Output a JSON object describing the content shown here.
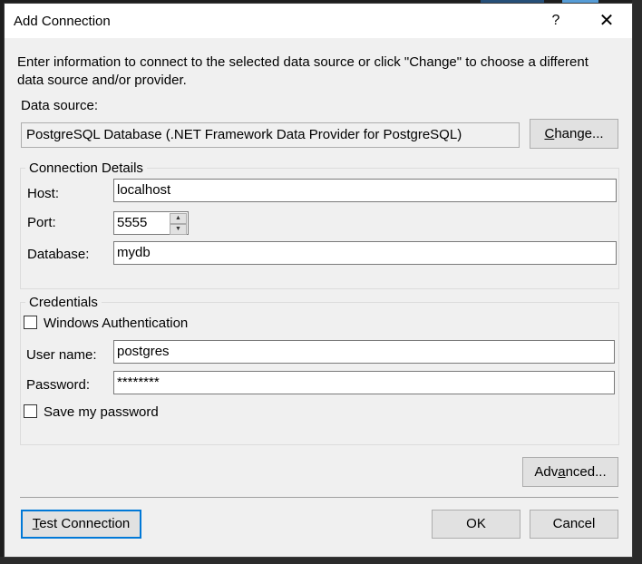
{
  "dialog": {
    "title": "Add Connection",
    "help_glyph": "?",
    "close_glyph": "✕",
    "intro": "Enter information to connect to the selected data source or click \"Change\" to choose a different data source and/or provider."
  },
  "data_source": {
    "label": "Data source:",
    "value": "PostgreSQL Database (.NET Framework Data Provider for PostgreSQL)",
    "change_label_pre": "",
    "change_label_u": "C",
    "change_label_post": "hange..."
  },
  "connection_details": {
    "title": "Connection Details",
    "host_label": "Host:",
    "host_value": "localhost",
    "port_label": "Port:",
    "port_value": "5555",
    "database_label": "Database:",
    "database_value": "mydb"
  },
  "credentials": {
    "title": "Credentials",
    "windows_auth_label": "Windows Authentication",
    "windows_auth_checked": false,
    "username_label": "User name:",
    "username_value": "postgres",
    "password_label": "Password:",
    "password_value": "********",
    "save_password_label": "Save my password",
    "save_password_checked": false
  },
  "buttons": {
    "advanced_pre": "Adv",
    "advanced_u": "a",
    "advanced_post": "nced...",
    "test_pre": "",
    "test_u": "T",
    "test_post": "est Connection",
    "ok": "OK",
    "cancel": "Cancel"
  },
  "colors": {
    "dialog_bg": "#f0f0f0",
    "focus_border": "#0078d7",
    "ide_bg": "#1e1e1e"
  }
}
